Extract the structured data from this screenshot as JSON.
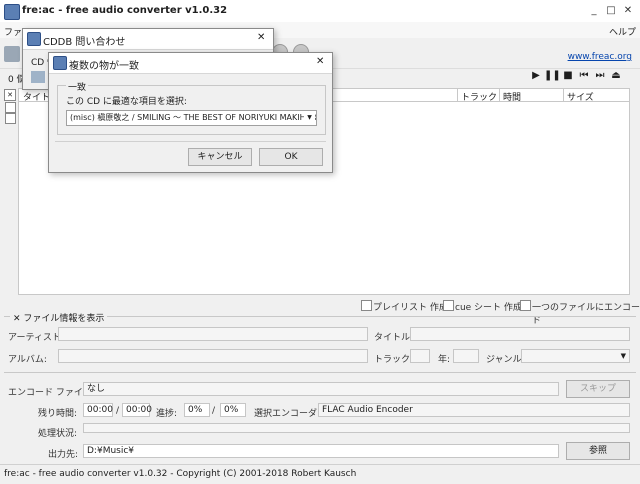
{
  "app": {
    "title": "fre:ac - free audio converter v1.0.32",
    "website": "www.freac.org"
  },
  "menu": {
    "file": "ファイ",
    "help": "ヘルプ"
  },
  "toolbar": {
    "count_prefix": "0 個"
  },
  "tracklist": {
    "columns": [
      "タイトル",
      "トラック",
      "時間",
      "サイズ"
    ]
  },
  "options": {
    "playlist": "プレイリスト 作成",
    "cue": "cue シート 作成",
    "single_file": "一つのファイルにエンコード"
  },
  "info": {
    "toggle": "ファイル情報を表示",
    "artist": "アーティスト:",
    "title": "タイトル:",
    "album": "アルバム:",
    "track": "トラック:",
    "year": "年:",
    "genre": "ジャンル:"
  },
  "encode": {
    "file_label": "エンコード ファイル:",
    "file_value": "なし",
    "skip_button": "スキップ",
    "remaining_label": "残り時間:",
    "remaining_value": "00:00",
    "slash": "/",
    "total_value": "00:00",
    "progress_label": "進捗:",
    "progress_value": "0%",
    "progress_total": "0%",
    "encoder_label": "選択エンコーダ:",
    "encoder_value": "FLAC Audio Encoder",
    "status_label": "処理状況:",
    "output_label": "出力先:",
    "output_value": "D:¥Music¥",
    "browse_button": "参照"
  },
  "statusbar": {
    "text": "fre:ac - free audio converter v1.0.32 - Copyright (C) 2001-2018 Robert Kausch"
  },
  "cddb_dialog": {
    "title": "CDDB 問い合わせ",
    "cd_label": "CD 情"
  },
  "match_dialog": {
    "title": "複数の物が一致",
    "group_label": "一致",
    "prompt": "この CD に最適な項目を選択:",
    "selected": "(misc) 槇原敬之 / SMILING ～ THE BEST OF NORIYUKI MAKIHARA",
    "cancel": "キャンセル",
    "ok": "OK"
  }
}
